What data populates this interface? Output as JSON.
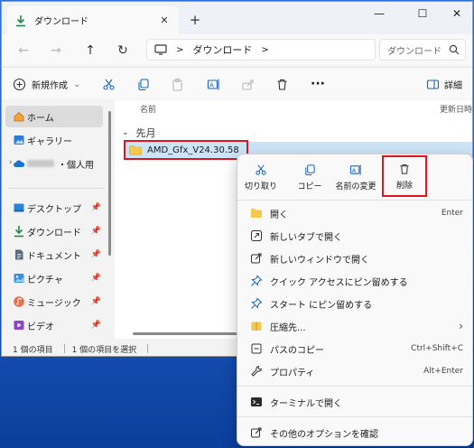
{
  "window": {
    "tab_title": "ダウンロード",
    "tab_close": "✕",
    "new_tab": "+",
    "minimize": "—",
    "maximize": "☐",
    "close": "✕"
  },
  "address": {
    "crumb_sep1": ">",
    "crumb": "ダウンロード",
    "crumb_sep2": ">",
    "search_placeholder": "ダウンロード"
  },
  "toolbar": {
    "new_label": "新規作成",
    "new_caret": "⌄",
    "more": "···",
    "details_label": "詳細"
  },
  "sidebar": {
    "items": [
      {
        "label": "ホーム"
      },
      {
        "label": "ギャラリー"
      },
      {
        "label": "・個人用"
      },
      {
        "label": "デスクトップ"
      },
      {
        "label": "ダウンロード"
      },
      {
        "label": "ドキュメント"
      },
      {
        "label": "ピクチャ"
      },
      {
        "label": "ミュージック"
      },
      {
        "label": "ビデオ"
      }
    ],
    "pin": "📌"
  },
  "main": {
    "col_name": "名前",
    "col_date": "更新日時",
    "group": "先月",
    "file_name": "AMD_Gfx_V24.30.58"
  },
  "status": {
    "count": "1 個の項目",
    "selected": "1 個の項目を選択"
  },
  "context_menu": {
    "top": {
      "cut": "切り取り",
      "copy": "コピー",
      "rename": "名前の変更",
      "delete": "削除"
    },
    "items": [
      {
        "label": "開く",
        "shortcut": "Enter"
      },
      {
        "label": "新しいタブで開く",
        "shortcut": ""
      },
      {
        "label": "新しいウィンドウで開く",
        "shortcut": ""
      },
      {
        "label": "クイック アクセスにピン留めする",
        "shortcut": ""
      },
      {
        "label": "スタート にピン留めする",
        "shortcut": ""
      },
      {
        "label": "圧縮先...",
        "shortcut": "›"
      },
      {
        "label": "パスのコピー",
        "shortcut": "Ctrl+Shift+C"
      },
      {
        "label": "プロパティ",
        "shortcut": "Alt+Enter"
      },
      {
        "label": "ターミナルで開く",
        "shortcut": ""
      },
      {
        "label": "その他のオプションを確認",
        "shortcut": ""
      }
    ]
  },
  "colors": {
    "selection": "#cce4f7",
    "highlight_box": "#e0161f",
    "accent": "#1976d2"
  }
}
